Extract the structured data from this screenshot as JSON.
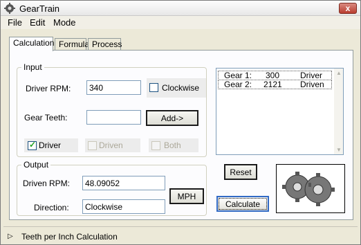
{
  "window": {
    "title": "GearTrain",
    "close_glyph": "x"
  },
  "menu": {
    "items": [
      "File",
      "Edit",
      "Mode"
    ]
  },
  "tabs": [
    {
      "label": "Calculation",
      "active": true
    },
    {
      "label": "Formula",
      "active": false
    },
    {
      "label": "Process",
      "active": false
    }
  ],
  "input_group": {
    "title": "Input",
    "driver_rpm_label": "Driver RPM:",
    "driver_rpm_value": "340",
    "clockwise_label": "Clockwise",
    "clockwise_checked": false,
    "gear_teeth_label": "Gear Teeth:",
    "gear_teeth_value": "",
    "add_button": "Add->",
    "driver_label": "Driver",
    "driver_checked": true,
    "driven_label": "Driven",
    "both_label": "Both"
  },
  "gear_list": {
    "rows": [
      {
        "name": "Gear 1:",
        "teeth": "300",
        "role": "Driver"
      },
      {
        "name": "Gear 2:",
        "teeth": "2121",
        "role": "Driven"
      }
    ]
  },
  "output_group": {
    "title": "Output",
    "driven_rpm_label": "Driven RPM:",
    "driven_rpm_value": "48.09052",
    "direction_label": "Direction:",
    "direction_value": "Clockwise",
    "mph_button": "MPH"
  },
  "buttons": {
    "reset": "Reset",
    "calculate": "Calculate"
  },
  "status": {
    "expander_glyph": "▷",
    "text": "Teeth per Inch Calculation"
  },
  "colors": {
    "accent": "#316ac5",
    "check": "#21a121",
    "frame": "#ece9d8"
  }
}
